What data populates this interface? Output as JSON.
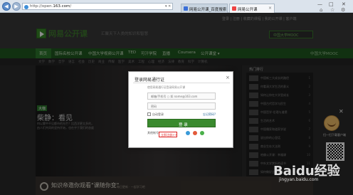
{
  "browser": {
    "url_prefix": "http://open.",
    "url_domain": "163.com",
    "url_suffix": "/",
    "address_tools": "▾ ✕",
    "tabs": [
      {
        "label": "网易公开课_百度搜索",
        "active": false
      },
      {
        "label": "网易公开课",
        "active": true
      }
    ],
    "window_controls": [
      "—",
      "□",
      "✕"
    ],
    "toolbar_icons": [
      "⌂",
      "☆",
      "⚙"
    ]
  },
  "site": {
    "brand": "网易公开课",
    "slogan": "汇聚天下人类的知识和智慧",
    "top_links": "登录 | 注册 | 收藏的课程 | 我的公开课 | 客户端",
    "app_button": "中国大学MOOC",
    "nav": [
      "首页",
      "国际名校公开课",
      "中国大学视频公开课",
      "TED",
      "可汗学院",
      "直播",
      "Coursera",
      "公开课堂 ▾"
    ],
    "nav_right": "中国大学MOOC",
    "sub_nav": [
      "文学",
      "数学",
      "哲学",
      "语言",
      "社会",
      "历史",
      "商业",
      "传媒",
      "医学",
      "美术",
      "工程",
      "心理",
      "经济",
      "法律",
      "教育",
      "科学",
      "计算机"
    ]
  },
  "hero": {
    "tag": "大咖",
    "title": "柴静：看见",
    "sub1": "何以雾中不见都市的光芒？比西洋更太多的，",
    "sub2": "由人们共同的坚持开始，也在乎于我们的态度"
  },
  "sidebar": {
    "header": "热门排行",
    "items": [
      {
        "text": "中国新三大成长的路径",
        "rank": "1"
      },
      {
        "text": "何看清大学生活的意义",
        "rank": "2"
      },
      {
        "text": "如何让你在大学里成长",
        "rank": "3"
      },
      {
        "text": "中国古代哲学与民生",
        "rank": "4"
      },
      {
        "text": "中国哲学-伦理与道德",
        "rank": "5"
      },
      {
        "text": "生活的艺术",
        "rank": "6"
      },
      {
        "text": "中国儒家和道家学说",
        "rank": "7"
      },
      {
        "text": "说出你的心里话",
        "rank": "8"
      },
      {
        "text": "商业生存大法则",
        "rank": "9"
      },
      {
        "text": "哈佛公开课：幸福课",
        "rank": "10"
      },
      {
        "text": "中外文学赏析的读书",
        "rank": "11"
      },
      {
        "text": "如何做好企业管理",
        "rank": "12"
      }
    ]
  },
  "ad": {
    "label": "扫一扫下载客户端",
    "close": "✕"
  },
  "footer_banner": {
    "text": "知识帝邀你观看\"课随你变\"",
    "sub": "每日更新 · 一起学习吧"
  },
  "modal": {
    "title": "登录网易通行证",
    "close": "×",
    "tip": "使用网易通行证登录网易公开课",
    "username_placeholder": "邮箱/手机号 ○ 如 name@163.com",
    "password_placeholder": "密码",
    "remember_label": "自动登录",
    "forgot_label": "忘记密码?",
    "login_button": "登 录",
    "other_label": "其他帐号",
    "register_label": "立即注册>>",
    "accent_green": "#3a8a2e",
    "highlight_red": "#dd2222"
  },
  "watermark": {
    "logo": "Baidu经验",
    "url": "jingyan.baidu.com"
  }
}
